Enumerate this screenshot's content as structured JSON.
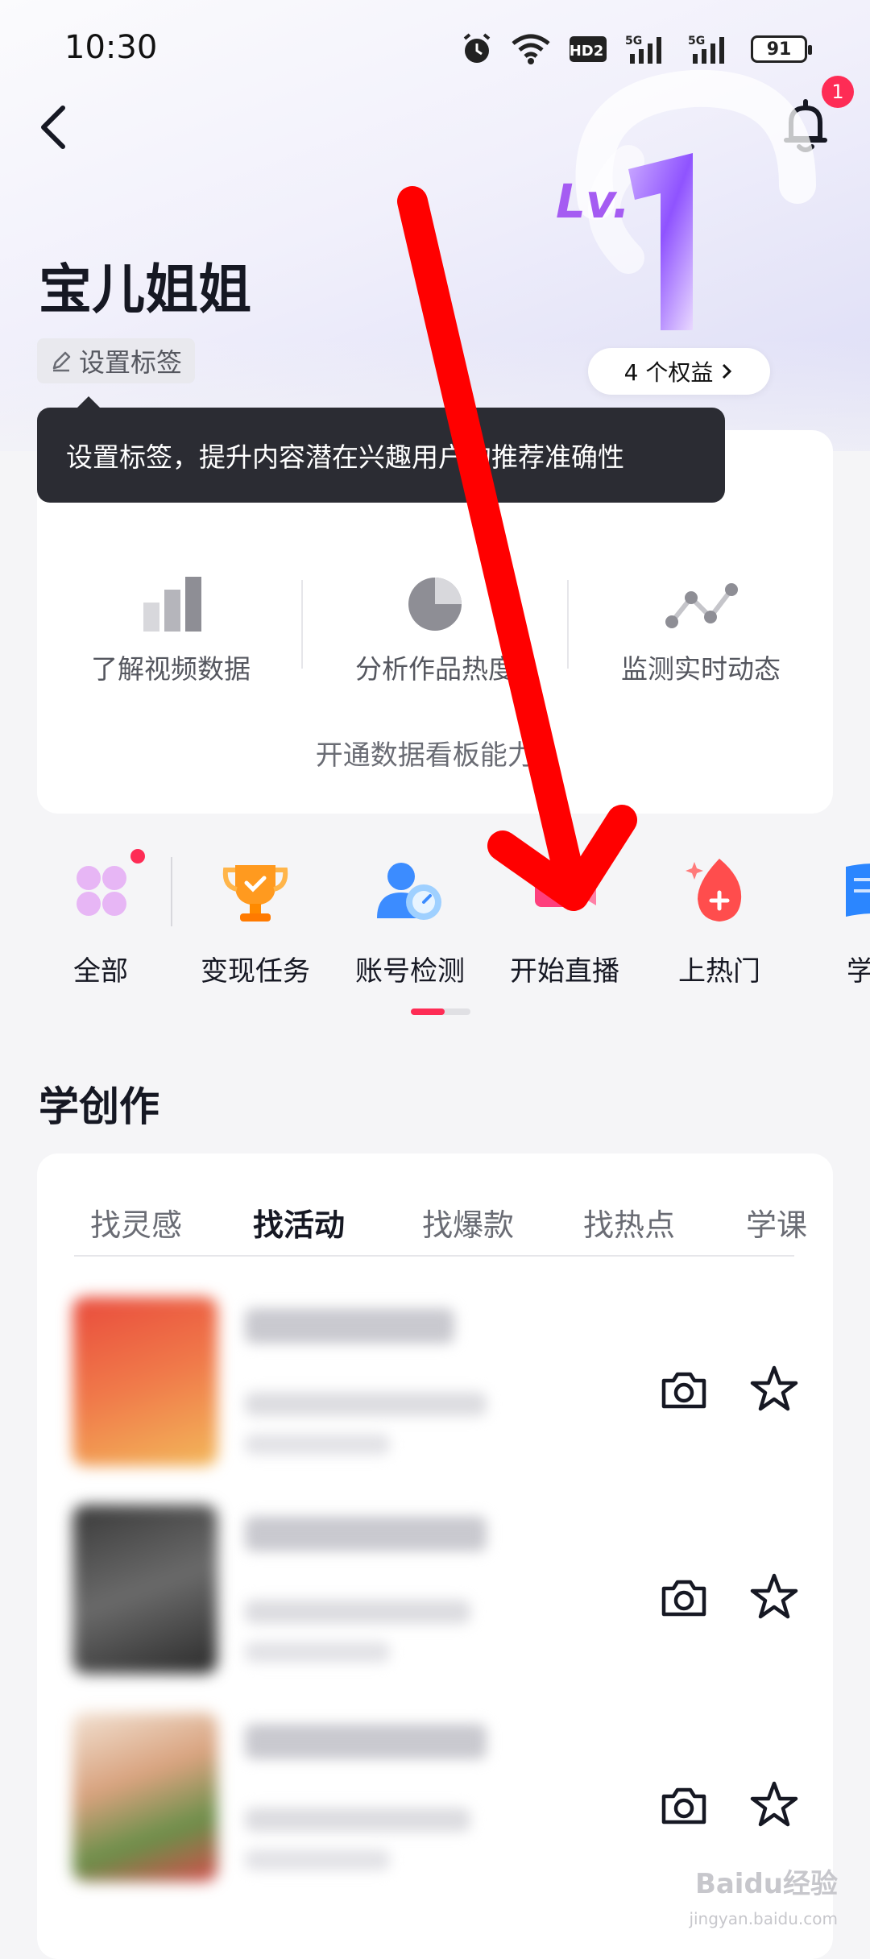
{
  "status_bar": {
    "time": "10:30",
    "battery": "91",
    "icons": [
      "alarm-icon",
      "wifi-icon",
      "hd-icon",
      "5g-signal-icon",
      "5g-signal-icon",
      "battery-icon"
    ],
    "hd_label": "HD2",
    "network_label": "5G"
  },
  "header": {
    "notification_count": "1",
    "level_prefix": "Lv.",
    "level": "1",
    "benefits_label": "4 个权益"
  },
  "profile": {
    "name": "宝儿姐姐",
    "tag_button_label": "设置标签",
    "tooltip": "设置标签，提升内容潜在兴趣用户的推荐准确性"
  },
  "data_card": {
    "features": [
      {
        "label": "了解视频数据",
        "icon": "bar-chart-icon"
      },
      {
        "label": "分析作品热度",
        "icon": "pie-chart-icon"
      },
      {
        "label": "监测实时动态",
        "icon": "line-chart-icon"
      }
    ],
    "cta": "开通数据看板能力"
  },
  "shortcuts": [
    {
      "label": "全部",
      "icon": "grid-icon"
    },
    {
      "label": "变现任务",
      "icon": "trophy-icon"
    },
    {
      "label": "账号检测",
      "icon": "account-check-icon"
    },
    {
      "label": "开始直播",
      "icon": "live-camera-icon"
    },
    {
      "label": "上热门",
      "icon": "fire-icon"
    },
    {
      "label": "学习",
      "icon": "book-icon"
    }
  ],
  "learn": {
    "title": "学创作",
    "tabs": [
      "找灵感",
      "找活动",
      "找爆款",
      "找热点",
      "学课"
    ],
    "active_tab": "找活动"
  },
  "watermark": {
    "main": "Baidu经验",
    "sub": "jingyan.baidu.com"
  },
  "colors": {
    "accent": "#fe2c55",
    "annotation_arrow": "#ff0000",
    "tooltip_bg": "#2b2c33"
  }
}
